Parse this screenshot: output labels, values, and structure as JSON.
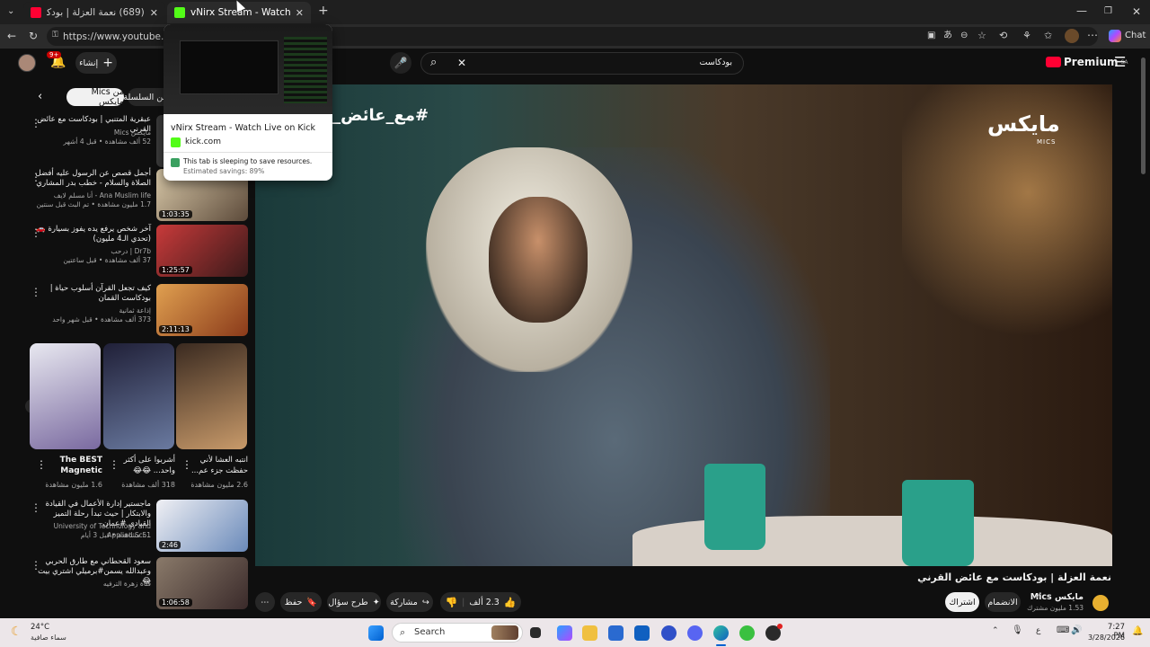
{
  "browser": {
    "tabs": [
      {
        "label": "(689) نعمة العزلة | بودكاست مع عائ",
        "favicon_color": "#ff0033",
        "active": false
      },
      {
        "label": "vNirx Stream - Watch Live on Kick",
        "favicon_color": "#53fc18",
        "active": true
      }
    ],
    "new_tab_label": "+",
    "url": "https://www.youtube.com/",
    "chat_label": "Chat",
    "hover_card": {
      "title": "vNirx Stream - Watch Live on Kick",
      "domain": "kick.com",
      "sleep_text": "This tab is sleeping to save resources.",
      "savings_text": "Estimated savings: 89%"
    }
  },
  "youtube": {
    "logo_text": "Premium",
    "region": "SA",
    "search_value": "بودكاست",
    "notification_count": "9+",
    "create_label": "إنشاء",
    "chips": [
      "من السلسلة",
      "من Mics مايكس"
    ],
    "overlay_hashtag": "#مع_عائض_ا",
    "channel_watermark": "مايكس",
    "channel_watermark_sub": "MICS",
    "video_title": "نعمة العزلة | بودكاست مع عائض القرني",
    "channel_name": "مايكس Mics",
    "subscribers": "1.53 مليون مشترك",
    "join_label": "الانضمام",
    "subscribed_label": "اشتراك",
    "like_count": "2.3 ألف",
    "share_label": "مشاركة",
    "ask_label": "طرح سؤال",
    "save_label": "حفظ",
    "sidebar_videos": [
      {
        "title": "عبقرية المتنبي | بودكاست مع عائض القرني",
        "channel": "مايكس Mics",
        "meta": "52 ألف مشاهدة • قبل 4 أشهر",
        "duration": "",
        "thumb_color": "#3a3a3a"
      },
      {
        "title": "أجمل قصص عن الرسول عليه أفضل الصلاة والسلام - خطب بدر المشاري",
        "channel": "Ana Muslim life - أنا مسلم لايف",
        "meta": "1.7 مليون مشاهدة • تم البث قبل سنتين",
        "duration": "1:03:35",
        "thumb_color": "#5c4a3a"
      },
      {
        "title": "آخر شخص يرفع يده يفوز بسيارة 🚗 (تحدي الـ4 مليون)",
        "channel": "Dr7b | درحب",
        "meta": "37 ألف مشاهدة • قبل ساعتين",
        "duration": "1:25:57",
        "thumb_color": "#8a2a2a"
      },
      {
        "title": "كيف تجعل القرآن أسلوب حياة | بودكاست القمان",
        "channel": "إذاعة ثمانية",
        "meta": "373 ألف مشاهدة • قبل شهر واحد",
        "duration": "2:11:13",
        "thumb_color": "#a04a2a"
      },
      {
        "title": "ماجستير إدارة الأعمال في القيادة والابتكار | حيث تبدأ رحلة التميز القيادي #عمان",
        "channel": "University of Technology and Applied Sci...",
        "meta": "51 مشاهدة • قبل 3 أيام",
        "duration": "2:46",
        "thumb_color": "#d8dde8"
      },
      {
        "title": "سعود القحطاني مع طارق الحربي وعبدالله يسمن#برميلي اشتري بيت 😂",
        "channel": "قناة زهرة الترفيه",
        "meta": "",
        "duration": "1:06:58",
        "thumb_color": "#6a5a4a"
      }
    ],
    "shorts": [
      {
        "title": "The BEST Magnetic",
        "views": "1.6 مليون مشاهدة",
        "color": "#d9d8e8"
      },
      {
        "title": "أشربوا على أكثر واحد... 😂😂",
        "views": "318 ألف مشاهدة",
        "color": "#3a3a55"
      },
      {
        "title": "انتبه العشا لأني حفظت جزء عم...",
        "views": "2.6 مليون مشاهدة",
        "color": "#b88a5a"
      }
    ]
  },
  "taskbar": {
    "weather_temp": "24°C",
    "weather_desc": "سماء صافية",
    "search_placeholder": "Search",
    "time": "7:27 PM",
    "date": "3/28/2026",
    "lang": "ع"
  }
}
